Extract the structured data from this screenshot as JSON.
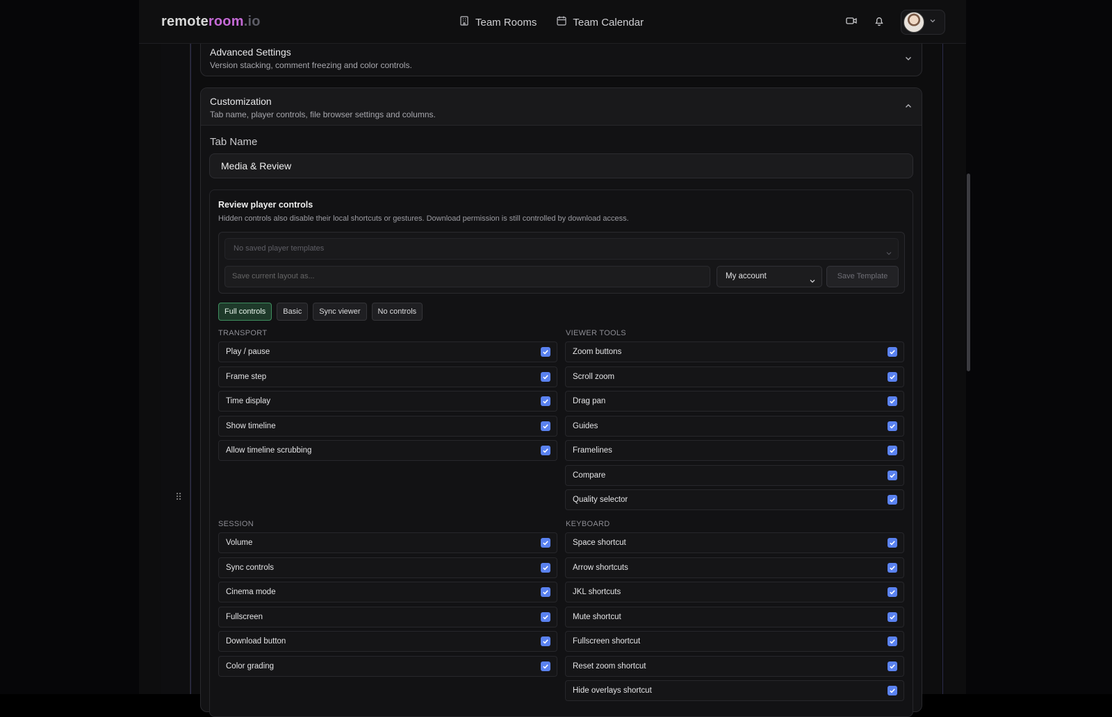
{
  "brand": {
    "part1": "remote",
    "part2": "room",
    "part3": ".io"
  },
  "nav": [
    {
      "label": "Team Rooms",
      "icon": "building-icon"
    },
    {
      "label": "Team Calendar",
      "icon": "calendar-icon"
    }
  ],
  "advanced": {
    "title": "Advanced Settings",
    "subtitle": "Version stacking, comment freezing and color controls."
  },
  "customization": {
    "title": "Customization",
    "subtitle": "Tab name, player controls, file browser settings and columns.",
    "tab_name_label": "Tab Name",
    "tab_name_value": "Media & Review"
  },
  "player": {
    "title": "Review player controls",
    "subtitle": "Hidden controls also disable their local shortcuts or gestures. Download permission is still controlled by download access.",
    "template_select_placeholder": "No saved player templates",
    "save_layout_placeholder": "Save current layout as...",
    "account_select": "My account",
    "save_template_label": "Save Template",
    "presets": [
      "Full controls",
      "Basic",
      "Sync viewer",
      "No controls"
    ],
    "active_preset": "Full controls"
  },
  "groups": {
    "transport": {
      "label": "TRANSPORT",
      "items": [
        "Play / pause",
        "Frame step",
        "Time display",
        "Show timeline",
        "Allow timeline scrubbing"
      ]
    },
    "viewer_tools": {
      "label": "VIEWER TOOLS",
      "items": [
        "Zoom buttons",
        "Scroll zoom",
        "Drag pan",
        "Guides",
        "Framelines",
        "Compare",
        "Quality selector"
      ]
    },
    "session": {
      "label": "SESSION",
      "items": [
        "Volume",
        "Sync controls",
        "Cinema mode",
        "Fullscreen",
        "Download button",
        "Color grading"
      ]
    },
    "keyboard": {
      "label": "KEYBOARD",
      "items": [
        "Space shortcut",
        "Arrow shortcuts",
        "JKL shortcuts",
        "Mute shortcut",
        "Fullscreen shortcut",
        "Reset zoom shortcut",
        "Hide overlays shortcut"
      ]
    }
  },
  "colors": {
    "accent_checkbox": "#5a82f0",
    "brand_room": "#c56ad6",
    "active_preset_bg": "#1e3a2a"
  }
}
